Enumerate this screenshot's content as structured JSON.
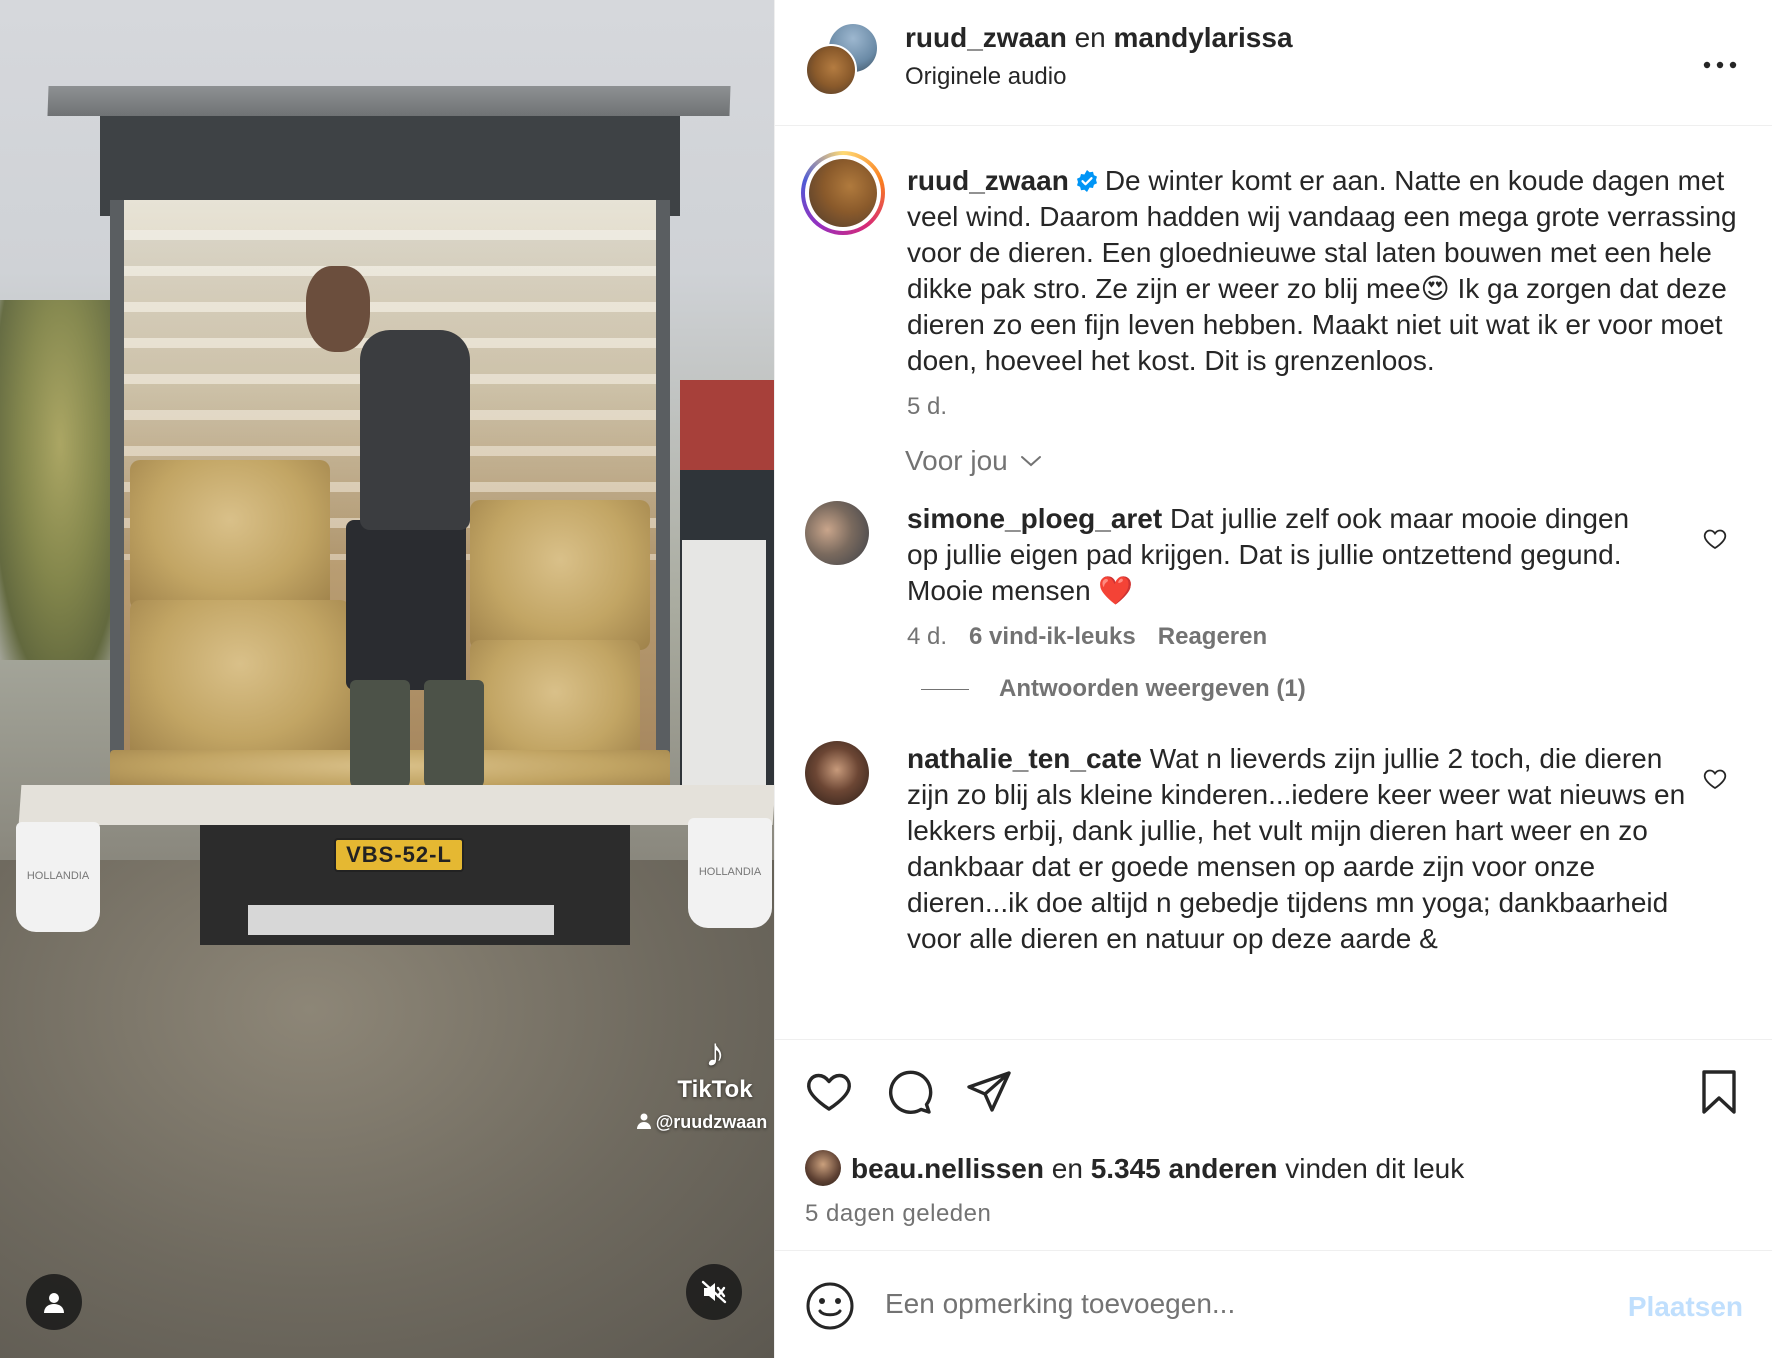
{
  "video": {
    "license_plate": "VBS-52-L",
    "bag_label": "HOLLANDIA",
    "watermark": {
      "brand": "TikTok",
      "handle": "@ruudzwaan"
    },
    "icons": {
      "account": "person-icon",
      "mute": "speaker-muted-icon"
    }
  },
  "header": {
    "user1": "ruud_zwaan",
    "joiner": "en",
    "user2": "mandylarissa",
    "audio": "Originele audio",
    "more": "..."
  },
  "caption": {
    "user": "ruud_zwaan",
    "verified": true,
    "text": "De winter komt er aan. Natte en koude dagen met veel wind. Daarom hadden wij vandaag een mega grote verrassing voor de dieren. Een gloednieuwe stal laten bouwen met een hele dikke pak stro. Ze zijn er weer zo blij mee😍 Ik ga zorgen dat deze dieren zo een fijn leven hebben. Maakt niet uit wat ik er voor moet doen, hoeveel het kost. Dit is grenzenloos.",
    "age": "5 d."
  },
  "sort_label": "Voor jou",
  "comments": [
    {
      "user": "simone_ploeg_aret",
      "text": "Dat jullie zelf ook maar mooie dingen op jullie eigen pad krijgen. Dat is jullie ontzettend gegund. Mooie mensen ❤️",
      "age": "4 d.",
      "likes": "6 vind-ik-leuks",
      "reply": "Reageren",
      "view_replies": "Antwoorden weergeven (1)"
    },
    {
      "user": "nathalie_ten_cate",
      "text": "Wat n lieverds zijn jullie 2 toch, die dieren zijn zo blij als kleine kinderen...iedere keer weer wat nieuws en lekkers erbij, dank jullie, het vult mijn dieren hart weer en zo dankbaar dat er goede mensen op aarde zijn voor onze dieren...ik doe altijd n gebedje tijdens mn yoga; dankbaarheid voor alle dieren en natuur op deze aarde &"
    }
  ],
  "likes": {
    "first_user": "beau.nellissen",
    "joiner": "en",
    "others": "5.345 anderen",
    "suffix": "vinden dit leuk"
  },
  "post_date": "5 dagen geleden",
  "composer": {
    "placeholder": "Een opmerking toevoegen...",
    "submit": "Plaatsen"
  },
  "colors": {
    "accent_blue": "#0095f6",
    "submit_disabled": "#c0dffd",
    "text_primary": "#262626",
    "text_secondary": "#737373"
  }
}
